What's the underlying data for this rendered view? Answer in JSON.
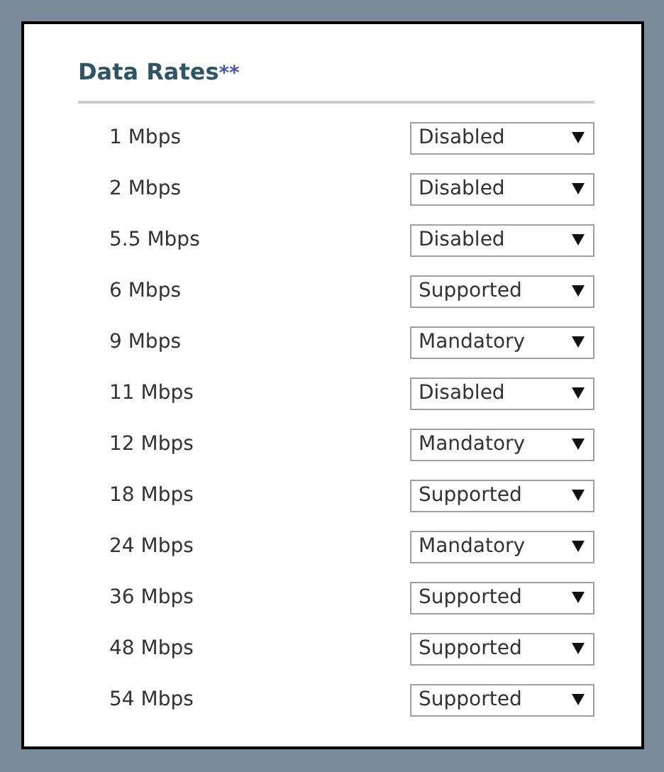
{
  "panel": {
    "title": "Data Rates",
    "required_mark": "**"
  },
  "rates": [
    {
      "label": "1 Mbps",
      "value": "Disabled"
    },
    {
      "label": "2 Mbps",
      "value": "Disabled"
    },
    {
      "label": "5.5 Mbps",
      "value": "Disabled"
    },
    {
      "label": "6 Mbps",
      "value": "Supported"
    },
    {
      "label": "9 Mbps",
      "value": "Mandatory"
    },
    {
      "label": "11 Mbps",
      "value": "Disabled"
    },
    {
      "label": "12 Mbps",
      "value": "Mandatory"
    },
    {
      "label": "18 Mbps",
      "value": "Supported"
    },
    {
      "label": "24 Mbps",
      "value": "Mandatory"
    },
    {
      "label": "36 Mbps",
      "value": "Supported"
    },
    {
      "label": "48 Mbps",
      "value": "Supported"
    },
    {
      "label": "54 Mbps",
      "value": "Supported"
    }
  ]
}
